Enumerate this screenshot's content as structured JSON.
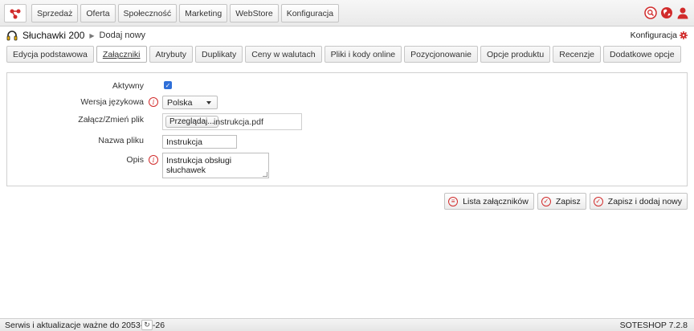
{
  "topnav": {
    "logo_icon": "soteshop-logo-icon",
    "items": [
      "Sprzedaż",
      "Oferta",
      "Społeczność",
      "Marketing",
      "WebStore",
      "Konfiguracja"
    ],
    "right_icons": [
      "search-icon",
      "globe-icon",
      "user-icon"
    ]
  },
  "breadcrumb": {
    "title": "Słuchawki 200",
    "current": "Dodaj nowy",
    "config_label": "Konfiguracja"
  },
  "tabs": [
    "Edycja podstawowa",
    "Załączniki",
    "Atrybuty",
    "Duplikaty",
    "Ceny w walutach",
    "Pliki i kody online",
    "Pozycjonowanie",
    "Opcje produktu",
    "Recenzje",
    "Dodatkowe opcje"
  ],
  "active_tab": "Załączniki",
  "form": {
    "active_label": "Aktywny",
    "active_checked": true,
    "language_label": "Wersja językowa",
    "language_value": "Polska",
    "file_label": "Załącz/Zmień plik",
    "browse_label": "Przeglądaj...",
    "file_name": "instrukcja.pdf",
    "name_label": "Nazwa pliku",
    "name_value": "Instrukcja",
    "desc_label": "Opis",
    "desc_value": "Instrukcja obsługi słuchawek"
  },
  "actions": {
    "list_label": "Lista załączników",
    "save_label": "Zapisz",
    "save_add_label": "Zapisz i dodaj nowy"
  },
  "footer": {
    "left": "Serwis i aktualizacje ważne do 2053-08-26",
    "right": "SOTESHOP 7.2.8"
  },
  "colors": {
    "accent_red": "#d12b2b",
    "checkbox_blue": "#2f6fd8"
  }
}
